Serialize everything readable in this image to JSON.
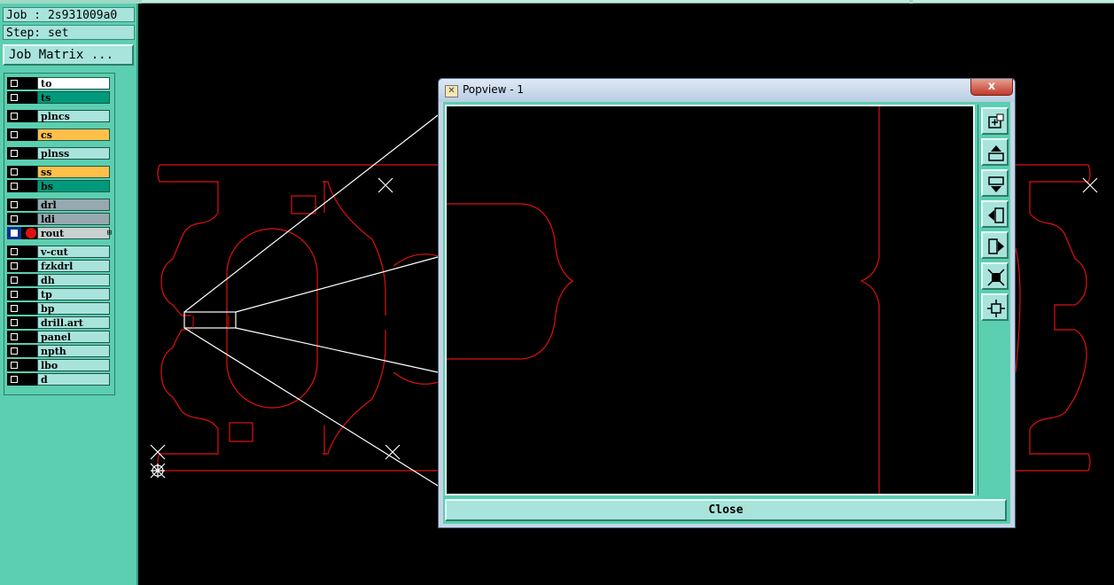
{
  "job": {
    "label": "Job : 2s931009a0"
  },
  "step": {
    "label": "Step: set"
  },
  "job_matrix_button": "Job Matrix ...",
  "layers": [
    {
      "name": "to",
      "color": "#ffffff"
    },
    {
      "name": "ts",
      "color": "#009a7a"
    },
    {
      "name": "plncs",
      "color": "#a8e4dc"
    },
    {
      "name": "cs",
      "color": "#ffc04a"
    },
    {
      "name": "plnss",
      "color": "#a8e4dc"
    },
    {
      "name": "ss",
      "color": "#ffc04a"
    },
    {
      "name": "bs",
      "color": "#009a7a"
    },
    {
      "name": "drl",
      "color": "#98a8b0"
    },
    {
      "name": "ldi",
      "color": "#98a8b0"
    },
    {
      "name": "rout",
      "color": "#c8d0d0",
      "active": true,
      "ext": "⊞"
    },
    {
      "name": "v-cut",
      "color": "#a8e4dc"
    },
    {
      "name": "fzkdrl",
      "color": "#a8e4dc"
    },
    {
      "name": "dh",
      "color": "#a8e4dc"
    },
    {
      "name": "tp",
      "color": "#a8e4dc"
    },
    {
      "name": "bp",
      "color": "#a8e4dc"
    },
    {
      "name": "drill.art",
      "color": "#a8e4dc"
    },
    {
      "name": "panel",
      "color": "#a8e4dc"
    },
    {
      "name": "npth",
      "color": "#a8e4dc"
    },
    {
      "name": "lbo",
      "color": "#a8e4dc"
    },
    {
      "name": "d",
      "color": "#a8e4dc"
    }
  ],
  "popup": {
    "title": "Popview - 1",
    "close_x": "x",
    "close_button": "Close",
    "app_icon": "x-icon",
    "tools": [
      "zoom-in-icon",
      "pan-up-icon",
      "pan-down-icon",
      "pan-left-icon",
      "pan-right-icon",
      "zoom-fit-icon",
      "zoom-home-icon"
    ]
  },
  "colors": {
    "route": "#e01010",
    "background": "#000000",
    "accent": "#5bcfb0"
  }
}
